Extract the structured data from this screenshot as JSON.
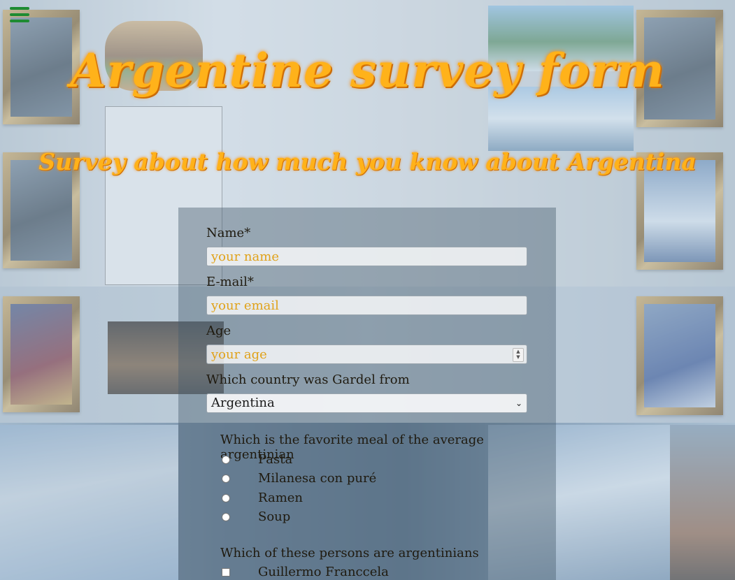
{
  "page": {
    "title": "Argentine survey form",
    "subtitle": "Survey about how much you know about Argentina"
  },
  "menu": {
    "icon": "hamburger-menu-icon"
  },
  "form": {
    "name": {
      "label": "Name*",
      "placeholder": "your name"
    },
    "email": {
      "label": "E-mail*",
      "placeholder": "your email"
    },
    "age": {
      "label": "Age",
      "placeholder": "your age"
    },
    "gardel": {
      "label": "Which country was Gardel from",
      "selected": "Argentina"
    },
    "meal": {
      "question": "Which is the favorite meal of the average argentinian",
      "options": [
        "Pasta",
        "Milanesa con puré",
        "Ramen",
        "Soup"
      ]
    },
    "persons": {
      "question": "Which of these persons are argentinians",
      "options": [
        "Guillermo Franccela"
      ]
    }
  },
  "colors": {
    "title": "#ffb21a",
    "title_glow": "#ff8a00",
    "menu_icon": "#1e8b32",
    "placeholder": "#e0a21a",
    "panel": "rgba(70,90,108,0.42)"
  }
}
